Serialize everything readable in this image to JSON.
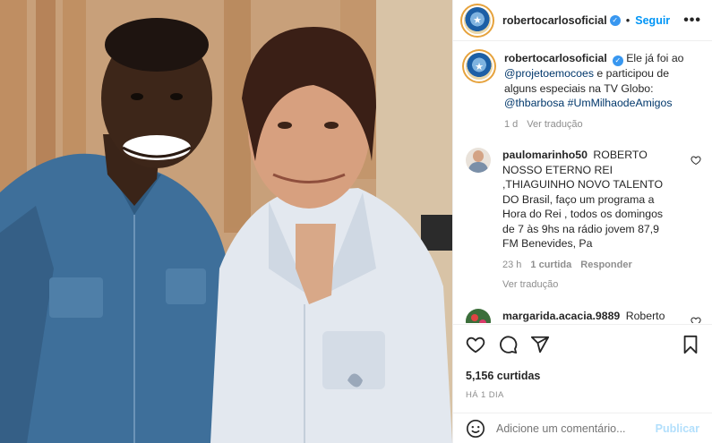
{
  "post": {
    "username": "robertocarlosoficial",
    "follow_label": "Seguir",
    "more_label": "•••",
    "dot": "•"
  },
  "caption": {
    "username": "robertocarlosoficial",
    "text_a": "Ele já foi ao",
    "mention_1": "@projetoemocoes",
    "text_b": "e participou de alguns especiais na TV Globo:",
    "mention_2": "@thbarbosa",
    "hashtag": "#UmMilhaodeAmigos",
    "age": "1 d",
    "translate": "Ver tradução"
  },
  "comments": [
    {
      "username": "paulomarinho50",
      "text": "ROBERTO NOSSO ETERNO REI ,THIAGUINHO NOVO TALENTO DO Brasil, faço um programa a Hora do Rei , todos os domingos de 7 às 9hs na rádio jovem 87,9 FM Benevides, Pa",
      "age": "23 h",
      "likes": "1 curtida",
      "reply": "Responder",
      "translate": "Ver tradução"
    },
    {
      "username": "margarida.acacia.9889",
      "text": "Roberto Carlos e melhor cantor do Brasil esse eu Réis doa em gue doe"
    }
  ],
  "stats": {
    "likes": "5,156 curtidas",
    "posted": "HÁ 1 DIA"
  },
  "comment_box": {
    "placeholder": "Adicione um comentário...",
    "publish_label": "Publicar"
  },
  "icons": [
    "like-icon",
    "comment-icon",
    "share-icon",
    "save-icon",
    "emoji-icon",
    "verified-badge-icon"
  ],
  "colors": {
    "link": "#0095f6",
    "verified": "#3897f0",
    "muted": "#8e8e8e",
    "mention": "#00376b"
  }
}
